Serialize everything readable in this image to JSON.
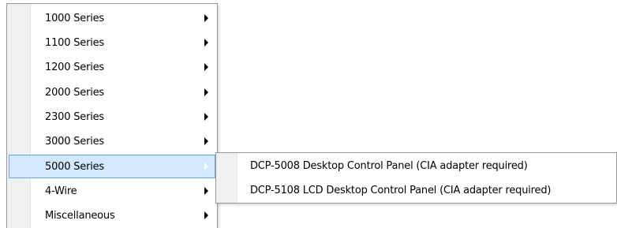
{
  "main_menu": {
    "items": [
      {
        "label": "1000 Series"
      },
      {
        "label": "1100 Series"
      },
      {
        "label": "1200 Series"
      },
      {
        "label": "2000 Series"
      },
      {
        "label": "2300 Series"
      },
      {
        "label": "3000 Series"
      },
      {
        "label": "5000 Series",
        "highlighted": true
      },
      {
        "label": "4-Wire"
      },
      {
        "label": "Miscellaneous"
      }
    ]
  },
  "sub_menu": {
    "items": [
      {
        "label": "DCP-5008 Desktop Control Panel (CIA adapter required)"
      },
      {
        "label": "DCP-5108 LCD Desktop Control Panel (CIA adapter required)"
      }
    ]
  },
  "colors": {
    "highlight_fill": "#d1e8ff",
    "highlight_border": "#66a7e8",
    "gutter": "#f0f0f0",
    "menu_border": "#979797"
  },
  "icons": {
    "submenu_arrow": "submenu-arrow-icon"
  }
}
